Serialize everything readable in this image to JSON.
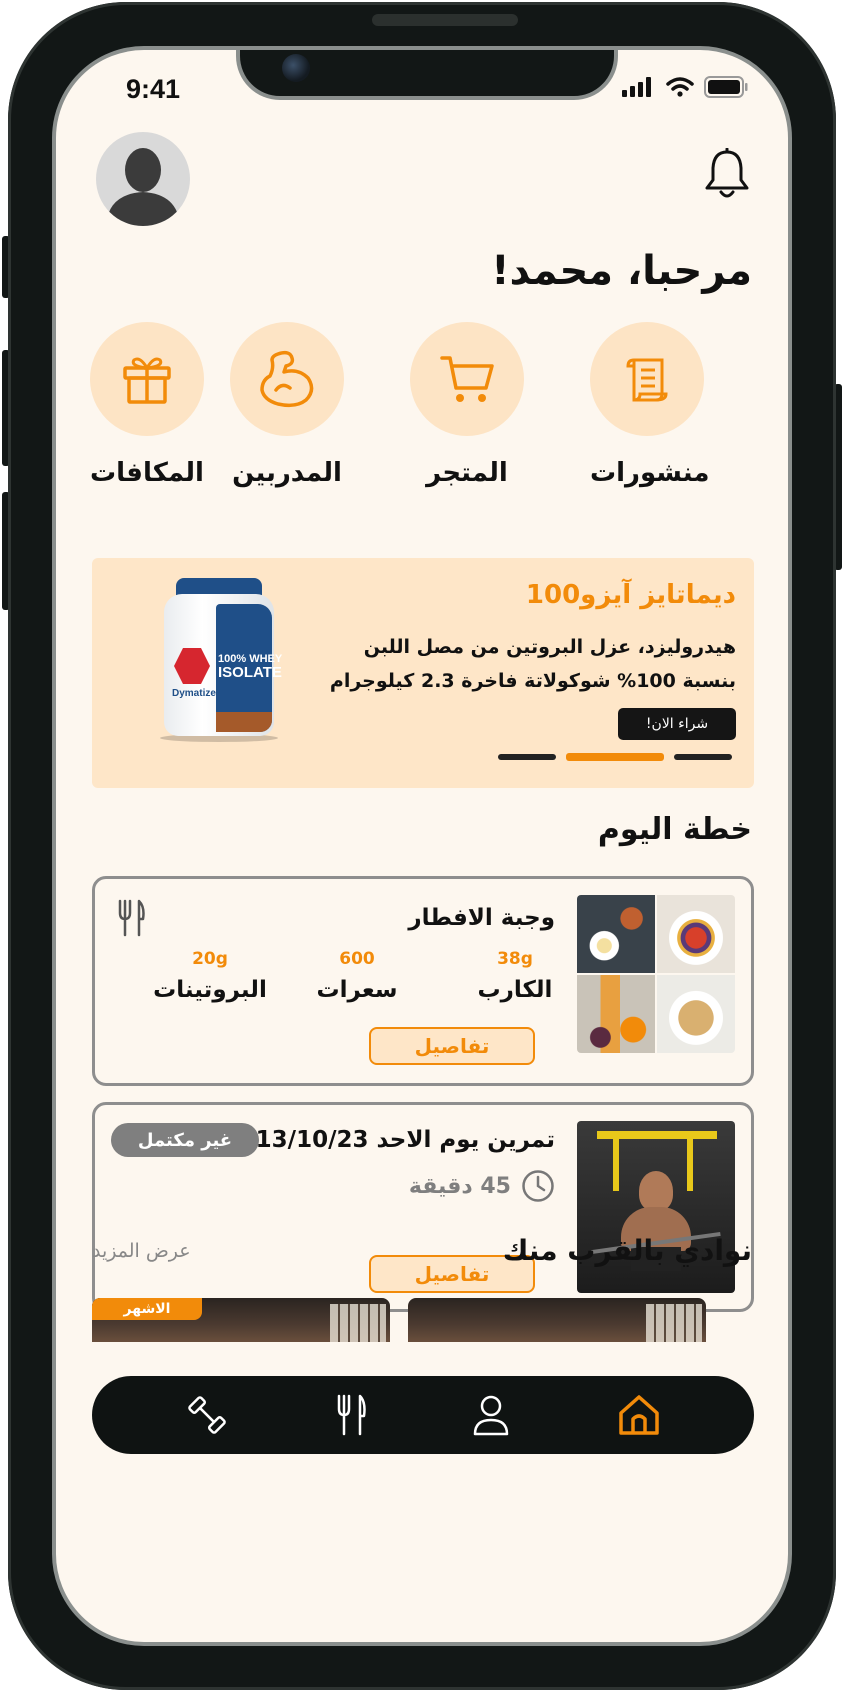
{
  "status": {
    "time": "9:41"
  },
  "greeting": "مرحبا، محمد!",
  "categories": [
    {
      "label": "منشورات",
      "icon": "scroll-icon"
    },
    {
      "label": "المتجر",
      "icon": "cart-icon"
    },
    {
      "label": "المدربين",
      "icon": "flexed-bicep-icon"
    },
    {
      "label": "المكافات",
      "icon": "gift-icon"
    }
  ],
  "banner": {
    "title": "ديماتايز آيزو100",
    "description": "هيدروليزد، عزل البروتين من مصل اللبن بنسبة 100% شوكولاتة فاخرة 2.3 كيلوجرام",
    "button": "شراء الان!",
    "product_label_1": "100% WHEY",
    "product_label_2": "ISOLATE",
    "brand": "Dymatize",
    "slides": 3,
    "active_slide": 2
  },
  "plan": {
    "title": "خطة اليوم",
    "meal": {
      "title": "وجبة الافطار",
      "stats": [
        {
          "value": "38g",
          "label": "الكارب"
        },
        {
          "value": "600",
          "label": "سعرات"
        },
        {
          "value": "20g",
          "label": "البروتينات"
        }
      ],
      "button": "تفاصيل"
    },
    "workout": {
      "title": "تمرين يوم الاحد 13/10/23",
      "status": "غير مكتمل",
      "duration": "45 دقيقة",
      "button": "تفاصيل"
    }
  },
  "clubs": {
    "title": "نوادي بالقرب منك",
    "see_more": "عرض المزيد",
    "badge": "الاشهر"
  },
  "colors": {
    "accent": "#f28b0a",
    "background": "#fdf7ef",
    "accent_soft": "#fde4c5"
  }
}
